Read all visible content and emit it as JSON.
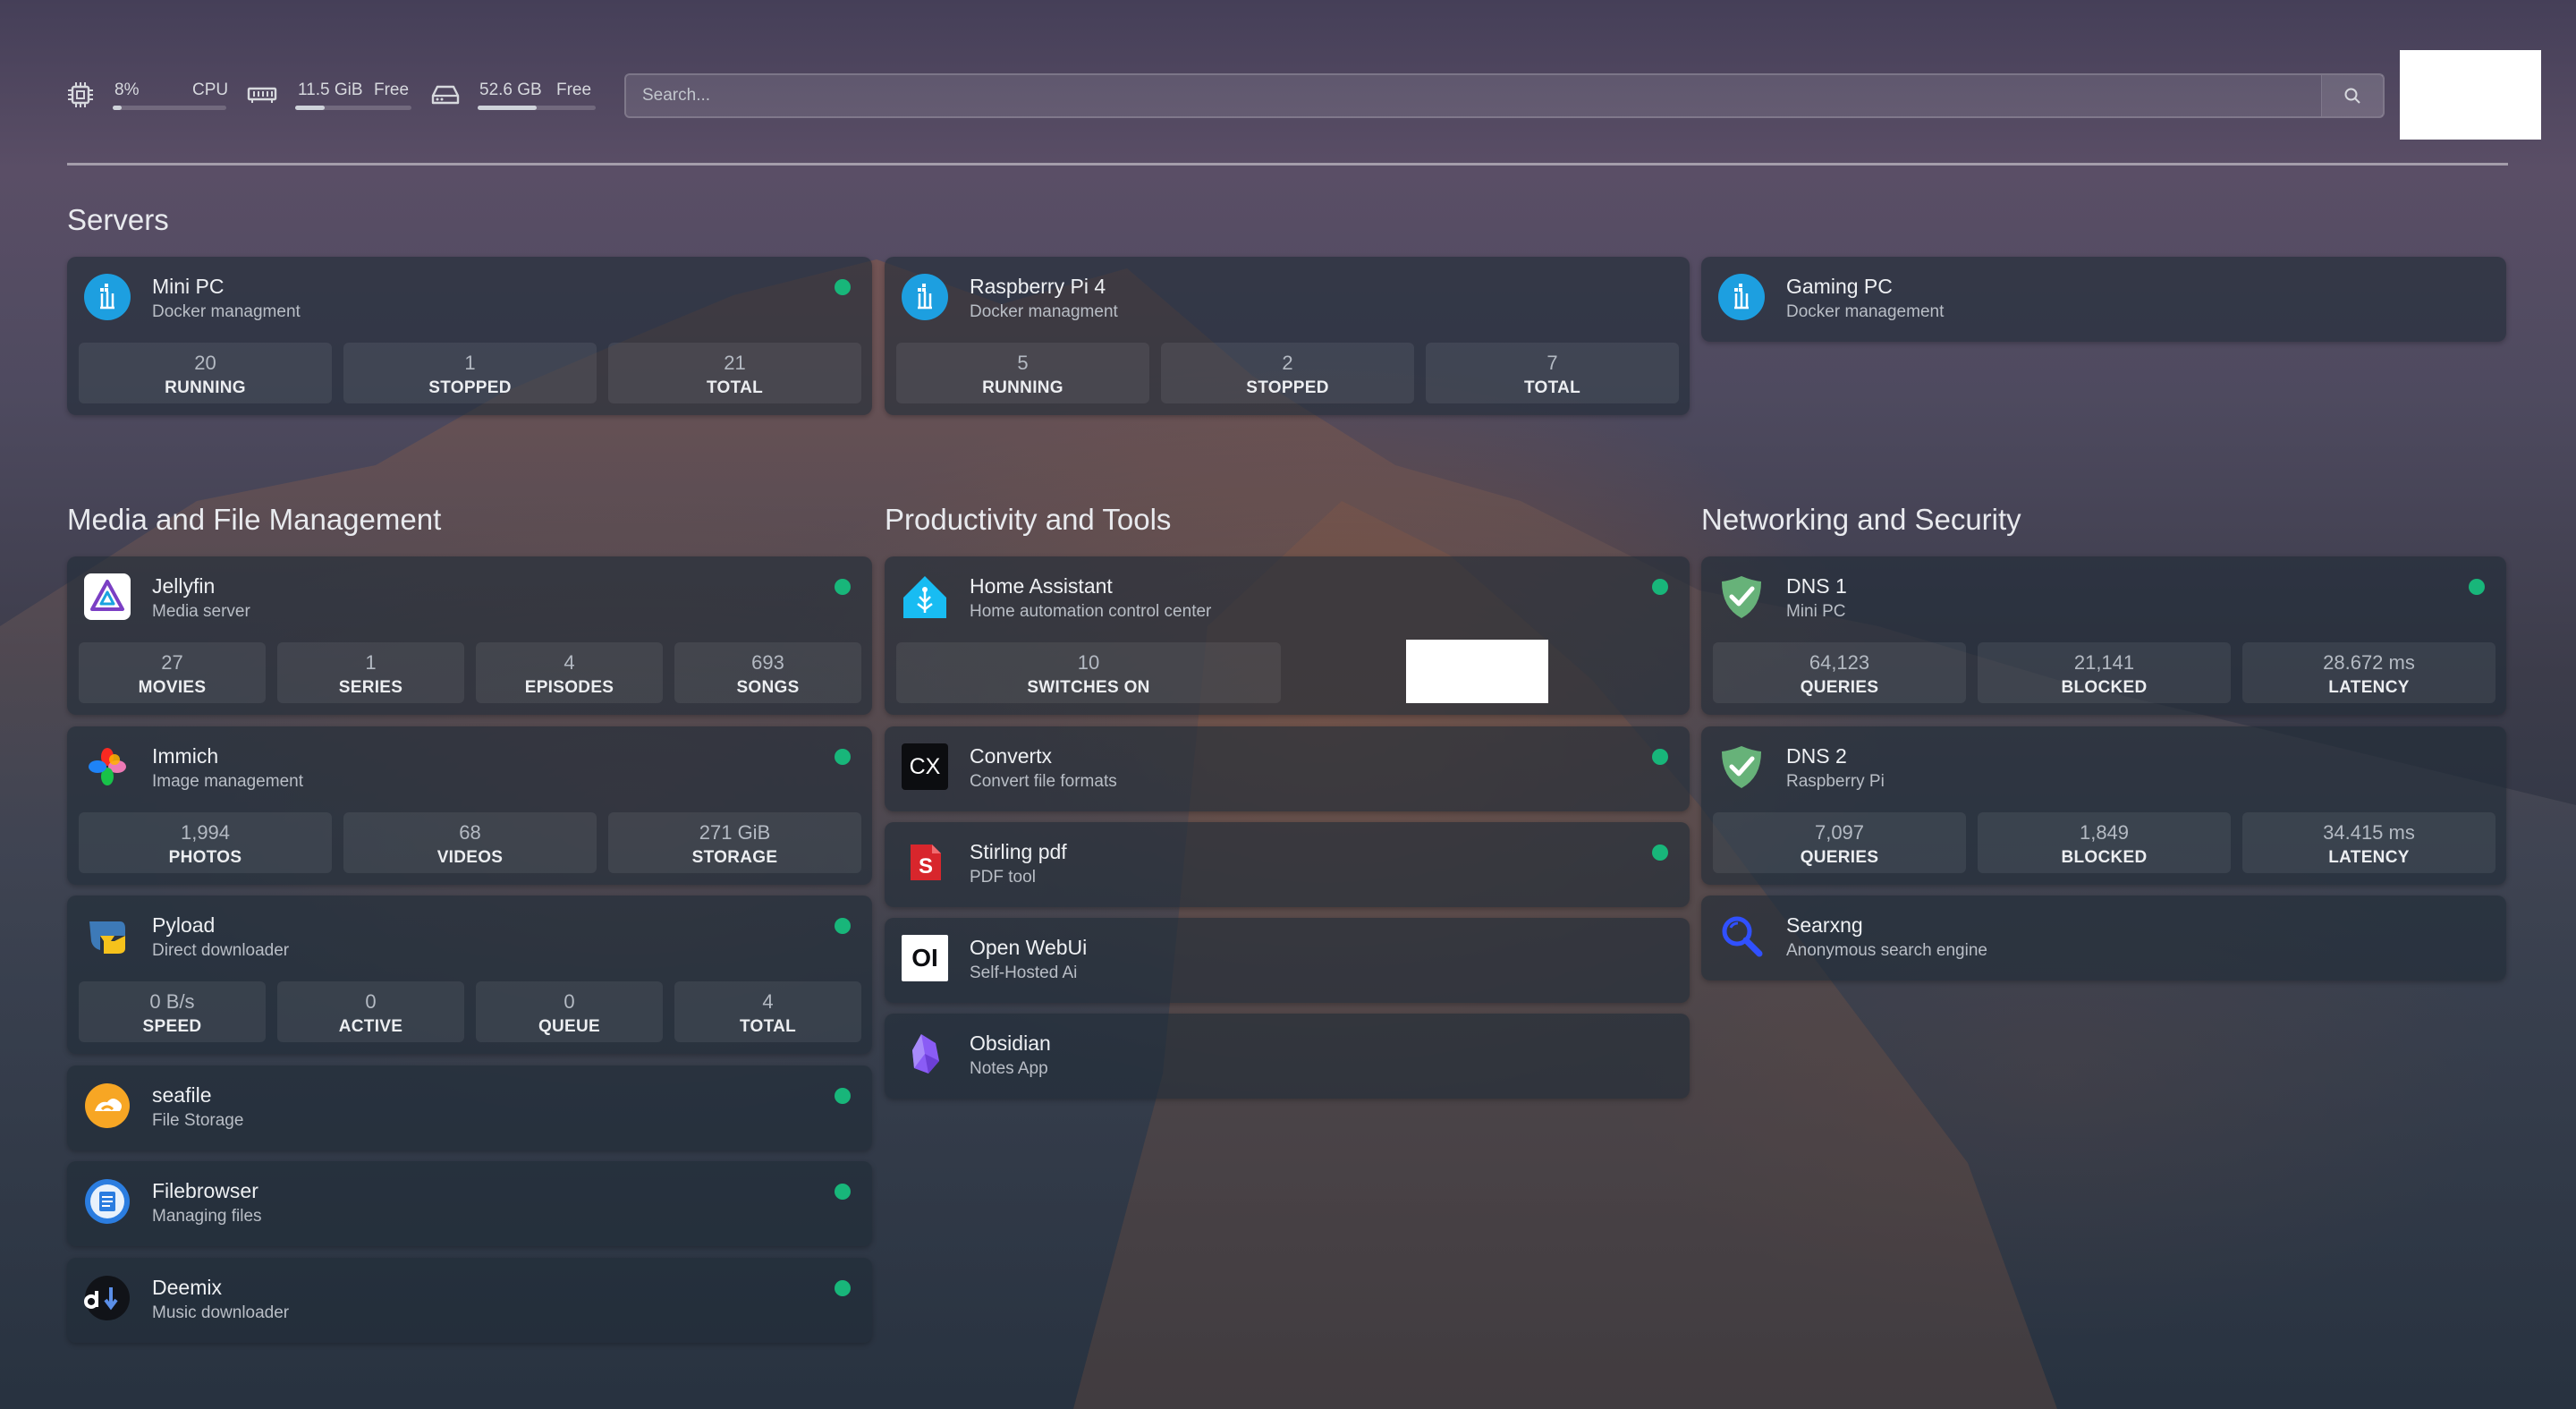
{
  "header": {
    "cpu": {
      "value": "8%",
      "label": "CPU",
      "fill": 0.08
    },
    "memory": {
      "value": "11.5 GiB",
      "label": "Free",
      "fill": 0.25
    },
    "disk": {
      "value": "52.6 GB",
      "label": "Free",
      "fill": 0.5
    },
    "search": {
      "placeholder": "Search..."
    }
  },
  "sections": {
    "servers": "Servers",
    "media": "Media and File Management",
    "productivity": "Productivity and Tools",
    "networking": "Networking and Security"
  },
  "servers": [
    {
      "title": "Mini PC",
      "subtitle": "Docker managment",
      "icon": "docker-icon",
      "status": "online",
      "stats": [
        {
          "value": "20",
          "label": "RUNNING"
        },
        {
          "value": "1",
          "label": "STOPPED"
        },
        {
          "value": "21",
          "label": "TOTAL"
        }
      ]
    },
    {
      "title": "Raspberry Pi 4",
      "subtitle": "Docker managment",
      "icon": "docker-icon",
      "stats": [
        {
          "value": "5",
          "label": "RUNNING"
        },
        {
          "value": "2",
          "label": "STOPPED"
        },
        {
          "value": "7",
          "label": "TOTAL"
        }
      ]
    },
    {
      "title": "Gaming PC",
      "subtitle": "Docker management",
      "icon": "docker-icon"
    }
  ],
  "media": [
    {
      "title": "Jellyfin",
      "subtitle": "Media server",
      "icon": "jellyfin-icon",
      "status": "online",
      "stats": [
        {
          "value": "27",
          "label": "MOVIES"
        },
        {
          "value": "1",
          "label": "SERIES"
        },
        {
          "value": "4",
          "label": "EPISODES"
        },
        {
          "value": "693",
          "label": "SONGS"
        }
      ]
    },
    {
      "title": "Immich",
      "subtitle": "Image management",
      "icon": "immich-icon",
      "status": "online",
      "stats": [
        {
          "value": "1,994",
          "label": "PHOTOS"
        },
        {
          "value": "68",
          "label": "VIDEOS"
        },
        {
          "value": "271 GiB",
          "label": "STORAGE"
        }
      ]
    },
    {
      "title": "Pyload",
      "subtitle": "Direct downloader",
      "icon": "pyload-icon",
      "status": "online",
      "stats": [
        {
          "value": "0 B/s",
          "label": "SPEED"
        },
        {
          "value": "0",
          "label": "ACTIVE"
        },
        {
          "value": "0",
          "label": "QUEUE"
        },
        {
          "value": "4",
          "label": "TOTAL"
        }
      ]
    },
    {
      "title": "seafile",
      "subtitle": "File Storage",
      "icon": "seafile-icon",
      "status": "online"
    },
    {
      "title": "Filebrowser",
      "subtitle": "Managing files",
      "icon": "filebrowser-icon",
      "status": "online"
    },
    {
      "title": "Deemix",
      "subtitle": "Music downloader",
      "icon": "deemix-icon",
      "status": "online"
    }
  ],
  "productivity": [
    {
      "title": "Home Assistant",
      "subtitle": "Home automation control center",
      "icon": "home-assistant-icon",
      "status": "online",
      "stats": [
        {
          "value": "10",
          "label": "SWITCHES ON"
        }
      ]
    },
    {
      "title": "Convertx",
      "subtitle": "Convert file formats",
      "icon": "convertx-icon",
      "icon_text": "CX",
      "status": "online"
    },
    {
      "title": "Stirling pdf",
      "subtitle": "PDF tool",
      "icon": "stirling-pdf-icon",
      "status": "online"
    },
    {
      "title": "Open WebUi",
      "subtitle": "Self-Hosted Ai",
      "icon": "open-webui-icon",
      "icon_text": "OI"
    },
    {
      "title": "Obsidian",
      "subtitle": "Notes App",
      "icon": "obsidian-icon"
    }
  ],
  "networking": [
    {
      "title": "DNS 1",
      "subtitle": "Mini PC",
      "icon": "adguard-icon",
      "status": "online",
      "stats": [
        {
          "value": "64,123",
          "label": "QUERIES"
        },
        {
          "value": "21,141",
          "label": "BLOCKED"
        },
        {
          "value": "28.672 ms",
          "label": "LATENCY"
        }
      ]
    },
    {
      "title": "DNS 2",
      "subtitle": "Raspberry Pi",
      "icon": "adguard-icon",
      "stats": [
        {
          "value": "7,097",
          "label": "QUERIES"
        },
        {
          "value": "1,849",
          "label": "BLOCKED"
        },
        {
          "value": "34.415 ms",
          "label": "LATENCY"
        }
      ]
    },
    {
      "title": "Searxng",
      "subtitle": "Anonymous search engine",
      "icon": "searxng-icon"
    }
  ],
  "colors": {
    "status_online": "#18b67a",
    "docker_blue": "#1d9fe0",
    "adguard_green": "#67b279"
  }
}
